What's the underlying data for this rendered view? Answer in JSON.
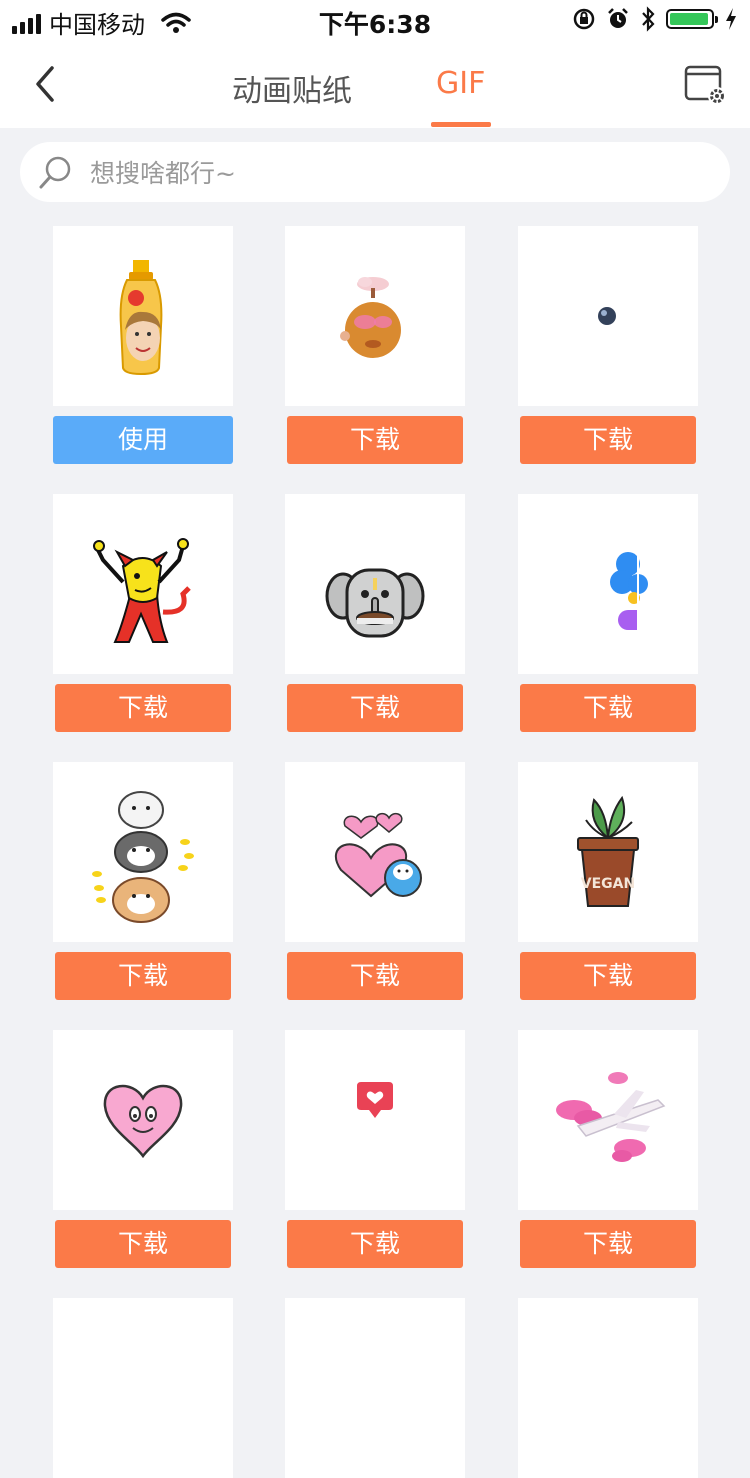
{
  "status_bar": {
    "carrier": "中国移动",
    "time": "下午6:38"
  },
  "nav": {
    "tab_sticker": "动画贴纸",
    "tab_gif": "GIF",
    "accent_color": "#fb7a48"
  },
  "search": {
    "placeholder": "想搜啥都行~"
  },
  "grid": {
    "items": [
      {
        "sticker": "shampoo-bottle-face",
        "button": "使用"
      },
      {
        "sticker": "angry-potato",
        "button": "下载"
      },
      {
        "sticker": "tiny-dot",
        "button": "下载"
      },
      {
        "sticker": "red-devil-dancing",
        "button": "下载"
      },
      {
        "sticker": "elephant-cake",
        "button": "下载"
      },
      {
        "sticker": "blue-flower-partial",
        "button": "下载"
      },
      {
        "sticker": "stacked-puppies",
        "button": "下载"
      },
      {
        "sticker": "pink-hearts-bear",
        "button": "下载"
      },
      {
        "sticker": "vegan-plant-pot",
        "button": "下载"
      },
      {
        "sticker": "pink-heart-face",
        "button": "下载"
      },
      {
        "sticker": "red-heart-badge",
        "button": "下载"
      },
      {
        "sticker": "pink-clouds-airplane",
        "button": "下载"
      }
    ]
  }
}
